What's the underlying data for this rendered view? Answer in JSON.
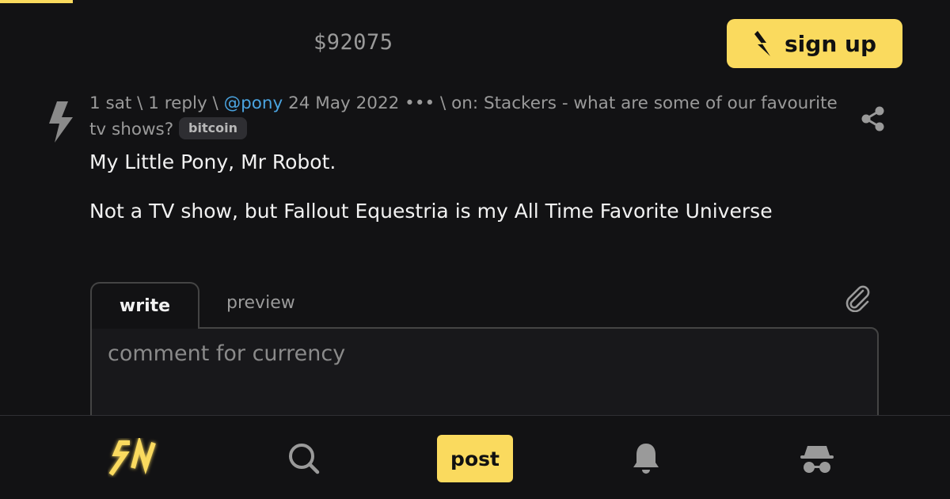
{
  "header": {
    "price": "$92075",
    "signup_label": "sign up"
  },
  "item": {
    "sats": "1 sat",
    "sep1": " \\ ",
    "replies": "1 reply",
    "sep2": " \\ ",
    "user": "@pony",
    "date": " 24 May 2022",
    "dots": " •••",
    "parent_prefix": " \\ on: ",
    "parent_title": "Stackers - what are some of our favourite tv shows?",
    "badge": "bitcoin",
    "paragraphs": [
      "My Little Pony, Mr Robot.",
      "Not a TV show, but Fallout Equestria is my All Time Favorite Universe"
    ]
  },
  "editor": {
    "tab_write": "write",
    "tab_preview": "preview",
    "placeholder": "comment for currency"
  },
  "bottom_nav": {
    "post_label": "post",
    "icons": [
      "sn-logo-icon",
      "search-icon",
      "bell-icon",
      "incognito-icon"
    ]
  },
  "colors": {
    "accent": "#fada5e",
    "background": "#121214",
    "link": "#4aa3df",
    "muted": "#9a9a9a"
  }
}
